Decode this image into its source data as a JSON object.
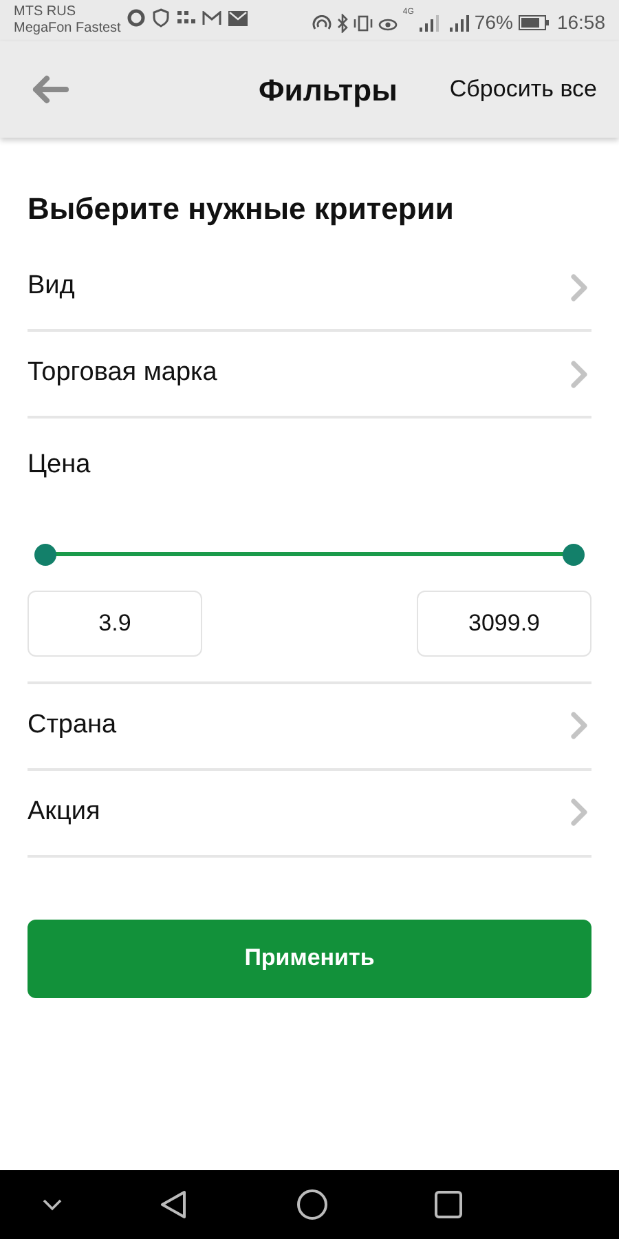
{
  "status_bar": {
    "carriers": [
      "MTS RUS",
      "MegaFon Fastest"
    ],
    "network_label": "4G",
    "battery_text": "76%",
    "time": "16:58"
  },
  "header": {
    "title": "Фильтры",
    "reset": "Сбросить все"
  },
  "heading": "Выберите нужные критерии",
  "criteria": [
    {
      "kind": "nav",
      "label": "Вид"
    },
    {
      "kind": "nav",
      "label": "Торговая марка"
    },
    {
      "kind": "range",
      "label": "Цена",
      "thumbs": [
        {
          "level": 0
        },
        {
          "level": 1
        }
      ],
      "min_value": "3.9",
      "max_value": "3099.9"
    },
    {
      "kind": "nav",
      "label": "Страна"
    },
    {
      "kind": "nav",
      "label": "Акция"
    }
  ],
  "apply_button": "Применить"
}
